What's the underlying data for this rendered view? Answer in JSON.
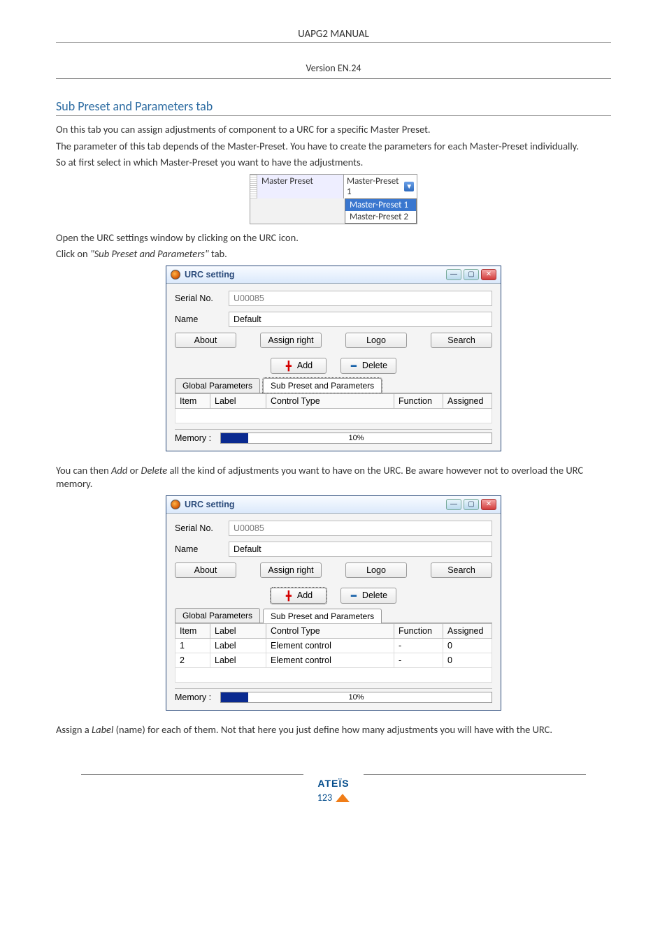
{
  "doc": {
    "header_title": "UAPG2  MANUAL",
    "header_version": "Version EN.24",
    "section_heading": "Sub Preset and Parameters tab",
    "para1": "On this tab you can assign adjustments of component to a URC for a specific Master Preset.",
    "para2": "The parameter of this tab depends of the Master-Preset. You have to create the parameters for each Master-Preset individually.",
    "para3": "So at first select in which Master-Preset you want to have the adjustments.",
    "para4a": "Open the URC settings window by clicking on the URC icon.",
    "para4b_pre": "Click on ",
    "para4b_quote": "\"Sub Preset and Parameters\"",
    "para4b_post": " tab.",
    "para5_pre": "You can then ",
    "para5_add": "Add",
    "para5_mid": " or ",
    "para5_del": "Delete",
    "para5_post": " all the kind of adjustments you want to have on the URC. Be aware however not to overload the URC memory.",
    "para6_pre": "Assign a ",
    "para6_label": "Label",
    "para6_post": " (name) for each of them. Not that here you just define how many adjustments you will have with the URC.",
    "footer_brand": "ATEÏS",
    "footer_page": "123"
  },
  "master_preset": {
    "label": "Master Preset",
    "selected": "Master-Preset 1",
    "options": [
      "Master-Preset 1",
      "Master-Preset 2"
    ]
  },
  "urc_window": {
    "title": "URC setting",
    "serial_label": "Serial No.",
    "serial_value": "U00085",
    "name_label": "Name",
    "name_value": "Default",
    "btn_about": "About",
    "btn_assign": "Assign right",
    "btn_logo": "Logo",
    "btn_search": "Search",
    "btn_add": "Add",
    "btn_delete": "Delete",
    "tab_global": "Global Parameters",
    "tab_sub": "Sub Preset and Parameters",
    "col_item": "Item",
    "col_label": "Label",
    "col_control": "Control Type",
    "col_function": "Function",
    "col_assigned": "Assigned",
    "memory_label": "Memory :",
    "memory_pct": "10%"
  },
  "urc_table2": {
    "rows": [
      {
        "item": "1",
        "label": "Label",
        "control": "Element control",
        "function": "-",
        "assigned": "0"
      },
      {
        "item": "2",
        "label": "Label",
        "control": "Element control",
        "function": "-",
        "assigned": "0"
      }
    ]
  }
}
